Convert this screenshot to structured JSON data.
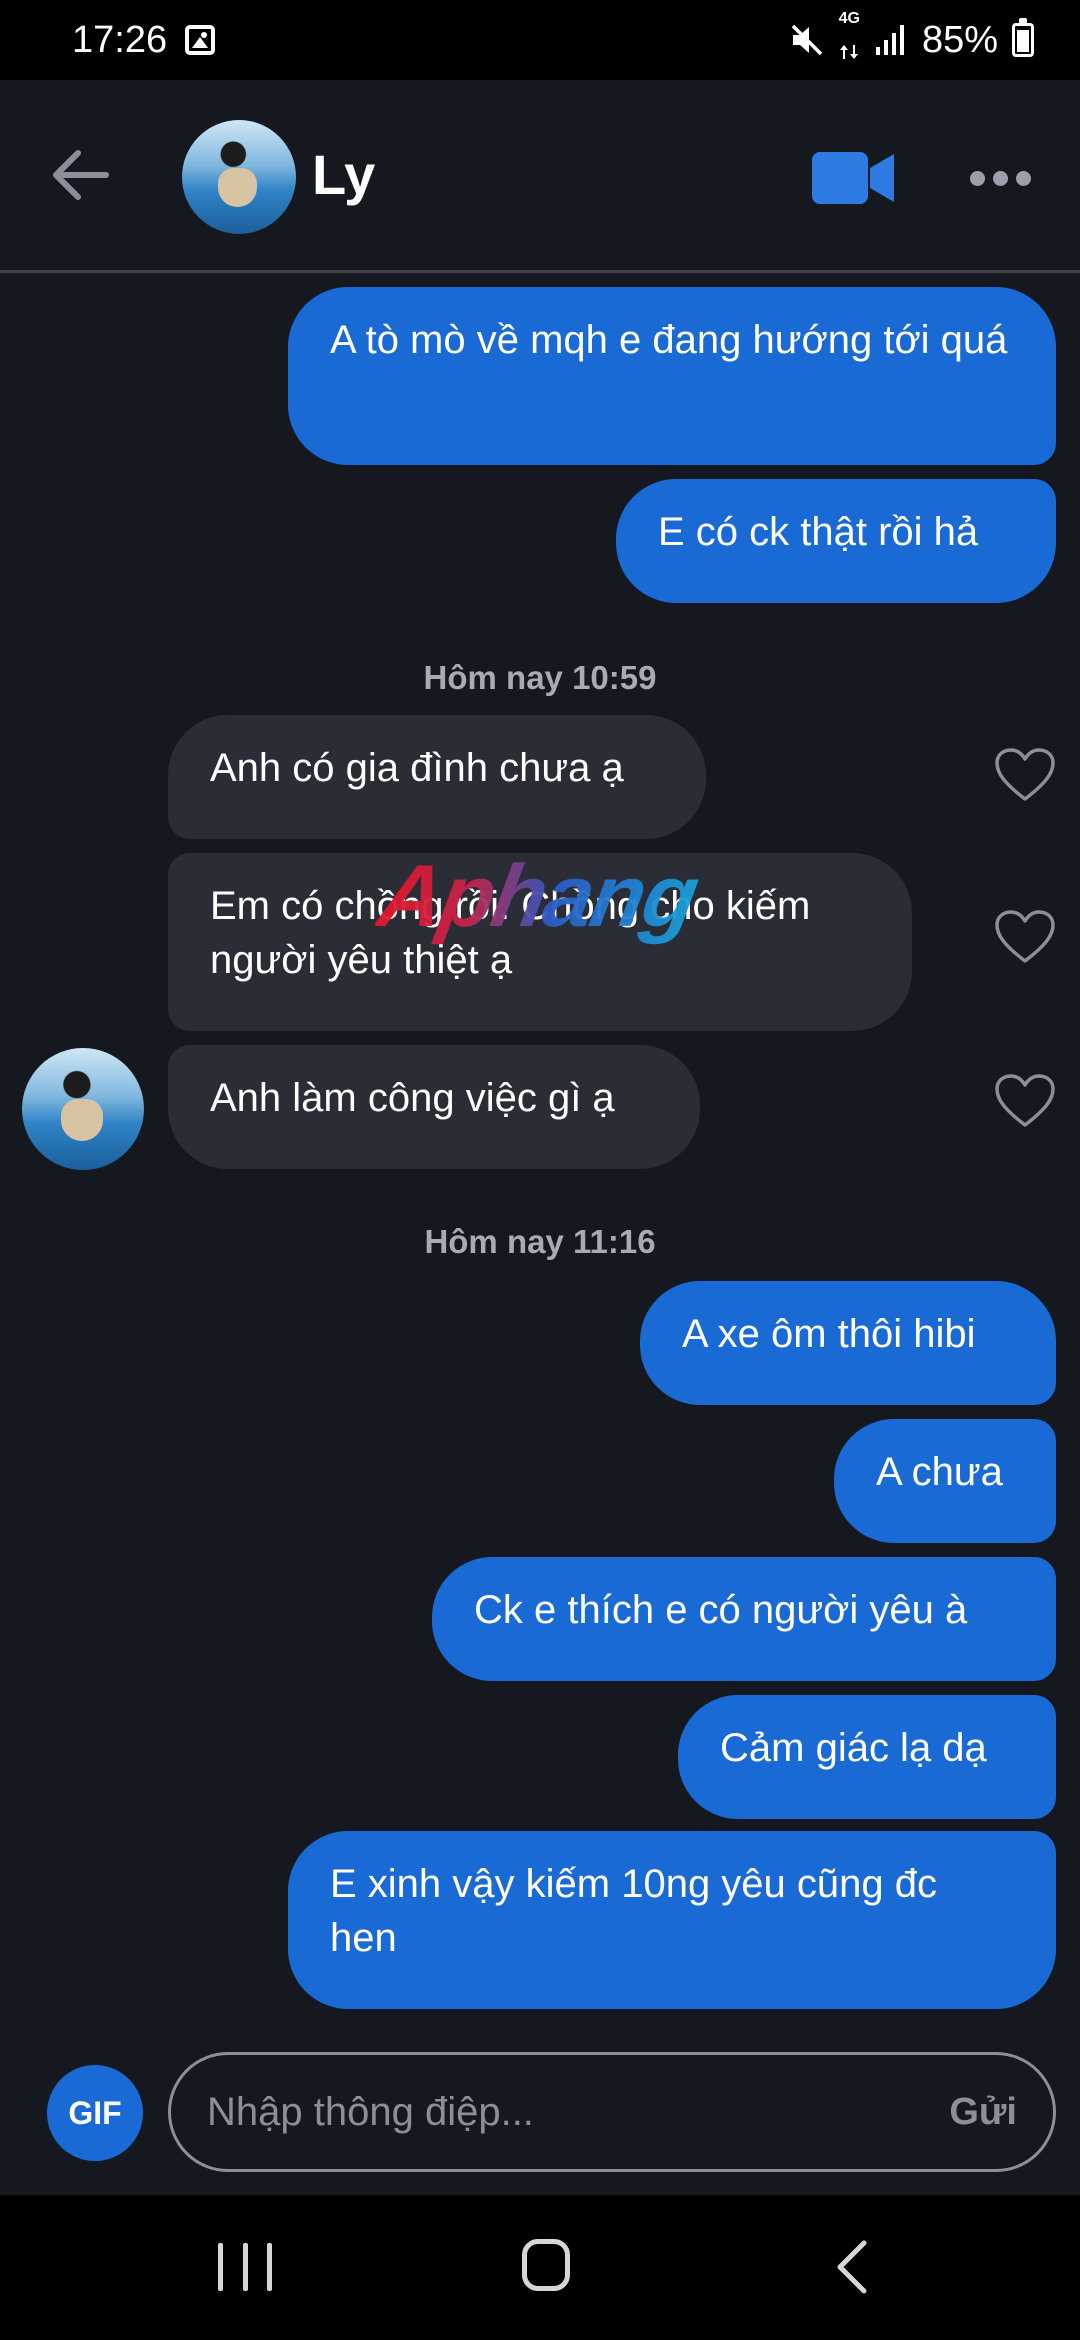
{
  "status_bar": {
    "time": "17:26",
    "network": "4G",
    "battery": "85%"
  },
  "header": {
    "contact_name": "Ly"
  },
  "messages": [
    {
      "id": "m1",
      "direction": "out",
      "text": "A tò mò về mqh e đang hướng tới quá"
    },
    {
      "id": "m2",
      "direction": "out",
      "text": "E có ck thật rồi hả"
    },
    {
      "id": "m3",
      "direction": "in",
      "text": "Anh có gia đình chưa ạ"
    },
    {
      "id": "m4",
      "direction": "in",
      "text": "Em có chồng rồi. Chồng cho kiếm người yêu thiệt ạ"
    },
    {
      "id": "m5",
      "direction": "in",
      "text": "Anh làm công việc gì ạ"
    },
    {
      "id": "m6",
      "direction": "out",
      "text": "A xe ôm thôi hibi"
    },
    {
      "id": "m7",
      "direction": "out",
      "text": "A chưa"
    },
    {
      "id": "m8",
      "direction": "out",
      "text": "Ck e thích e có người yêu à"
    },
    {
      "id": "m9",
      "direction": "out",
      "text": "Cảm giác lạ dạ"
    },
    {
      "id": "m10",
      "direction": "out",
      "text": "E xinh vậy kiếm 10ng yêu cũng đc hen"
    }
  ],
  "timestamps": {
    "t1": "Hôm nay 10:59",
    "t2": "Hôm nay 11:16"
  },
  "watermark": "Aphang",
  "composer": {
    "gif_label": "GIF",
    "placeholder": "Nhập thông điệp...",
    "send_label": "Gửi"
  },
  "colors": {
    "outgoing_bubble": "#1a6ad6",
    "incoming_bubble": "#2a2d35",
    "background": "#15181e",
    "accent": "#2d7be0"
  }
}
